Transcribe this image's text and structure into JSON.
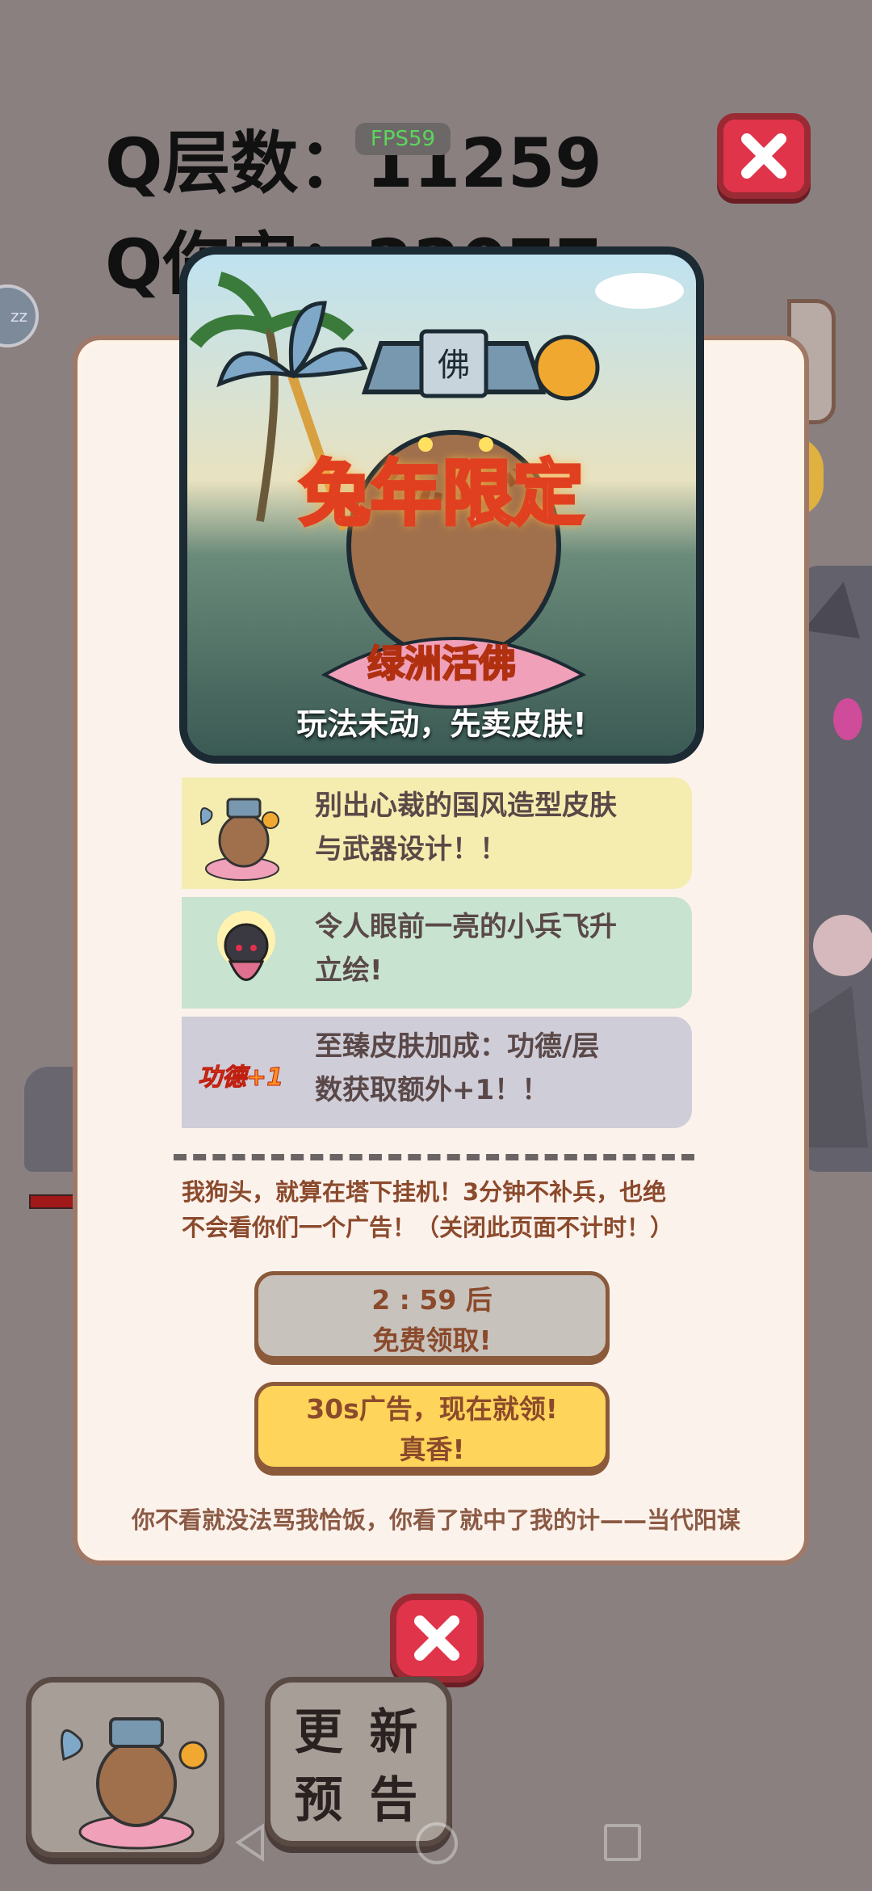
{
  "hud": {
    "layer_label": "Q层数：",
    "layer_value": "11259",
    "damage_label": "Q伤害：",
    "damage_value": "22077",
    "fps": "FPS59",
    "close_icon": "close-icon"
  },
  "side": {
    "left_badge": "zz"
  },
  "banner": {
    "title": "兔年限定",
    "subtitle": "绿洲活佛",
    "caption": "玩法未动，先卖皮肤!",
    "hat_glyph": "佛"
  },
  "features": [
    {
      "line1": "别出心裁的国风造型皮肤",
      "line2": "与武器设计！！",
      "bg": "#f5edb0",
      "icon": "skin-figure-icon"
    },
    {
      "line1": "令人眼前一亮的小兵飞升",
      "line2": "立绘!",
      "bg": "#c8e3d0",
      "icon": "minion-icon"
    },
    {
      "line1": "至臻皮肤加成：功德/层",
      "line2": "数获取额外+1！！",
      "bg": "#cfcdd8",
      "icon_text": "功德+1"
    }
  ],
  "notice": {
    "line1": "我狗头，就算在塔下挂机！3分钟不补兵，也绝",
    "line2": "不会看你们一个广告！（关闭此页面不计时！）"
  },
  "buttons": {
    "timer_line1": "2 : 59 后",
    "timer_line2": "免费领取!",
    "ad_line1": "30s广告，现在就领!",
    "ad_line2": "真香!"
  },
  "footer": "你不看就没法骂我恰饭，你看了就中了我的计——当代阳谋",
  "bottom": {
    "update_line1": "更 新",
    "update_line2": "预 告"
  },
  "colors": {
    "overlay_bg": "#8a8080",
    "close_red": "#e0344a",
    "ad_yellow": "#ffd45a",
    "timer_grey": "#c8c2bc"
  }
}
